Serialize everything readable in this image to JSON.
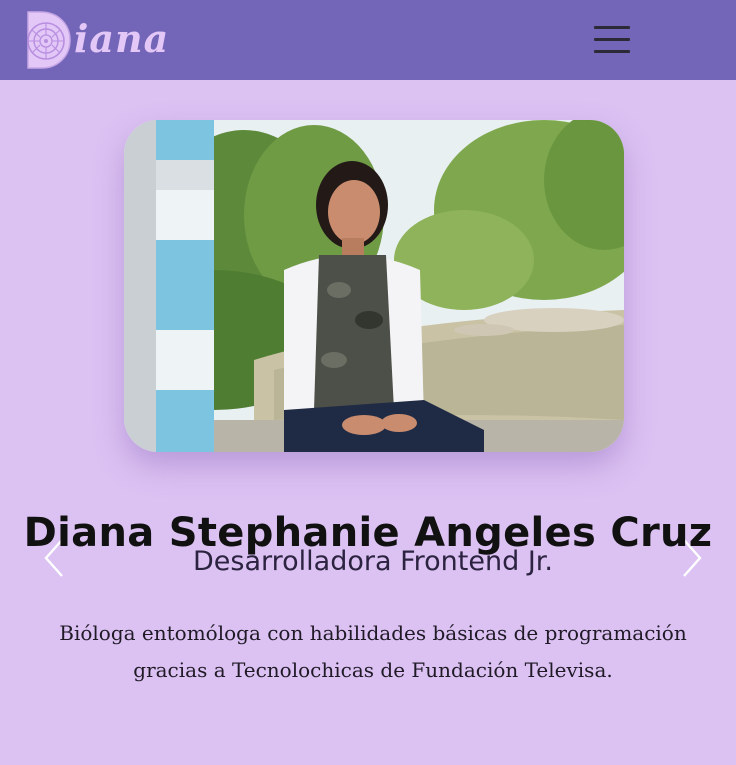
{
  "header": {
    "logo_text": "iana",
    "menu_icon": "hamburger-menu-icon"
  },
  "profile": {
    "name": "Diana Stephanie Angeles Cruz",
    "role": "Desarrolladora Frontend Jr.",
    "description": "Bióloga entomóloga con habilidades básicas de programación gracias a Tecnolochicas de Fundación Televisa.",
    "photo_icon": "profile-photo"
  },
  "carousel": {
    "prev_icon": "chevron-left-icon",
    "next_icon": "chevron-right-icon"
  },
  "colors": {
    "navbar": "#7366b8",
    "background": "#dcc2f3",
    "logo": "#e2c7f7",
    "text": "#111111"
  }
}
